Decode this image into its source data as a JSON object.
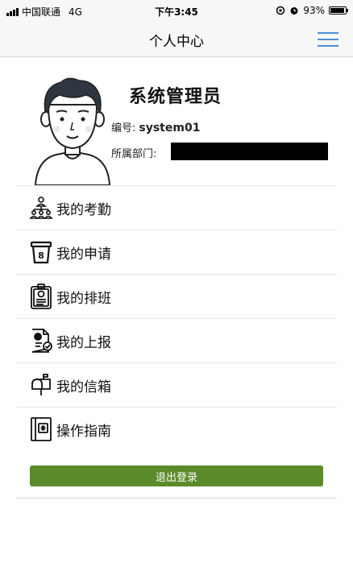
{
  "status_bar": {
    "carrier": "中国联通",
    "network": "4G",
    "time": "下午3:45",
    "battery": "93%",
    "battery_level": 0.93
  },
  "header": {
    "title": "个人中心",
    "menu_icon": "hamburger-menu-icon"
  },
  "profile": {
    "name": "系统管理员",
    "id_label": "编号:",
    "id_value": "system01",
    "dept_label": "所属部门:"
  },
  "menu": {
    "items": [
      {
        "label": "我的考勤",
        "icon": "org-chart-icon"
      },
      {
        "label": "我的申请",
        "icon": "trash-can-icon"
      },
      {
        "label": "我的排班",
        "icon": "clipboard-icon"
      },
      {
        "label": "我的上报",
        "icon": "document-check-icon"
      },
      {
        "label": "我的信箱",
        "icon": "mailbox-icon"
      },
      {
        "label": "操作指南",
        "icon": "guide-book-icon"
      }
    ]
  },
  "logout_label": "退出登录",
  "colors": {
    "accent": "#4a8fd9",
    "logout": "#5a8a2a"
  }
}
